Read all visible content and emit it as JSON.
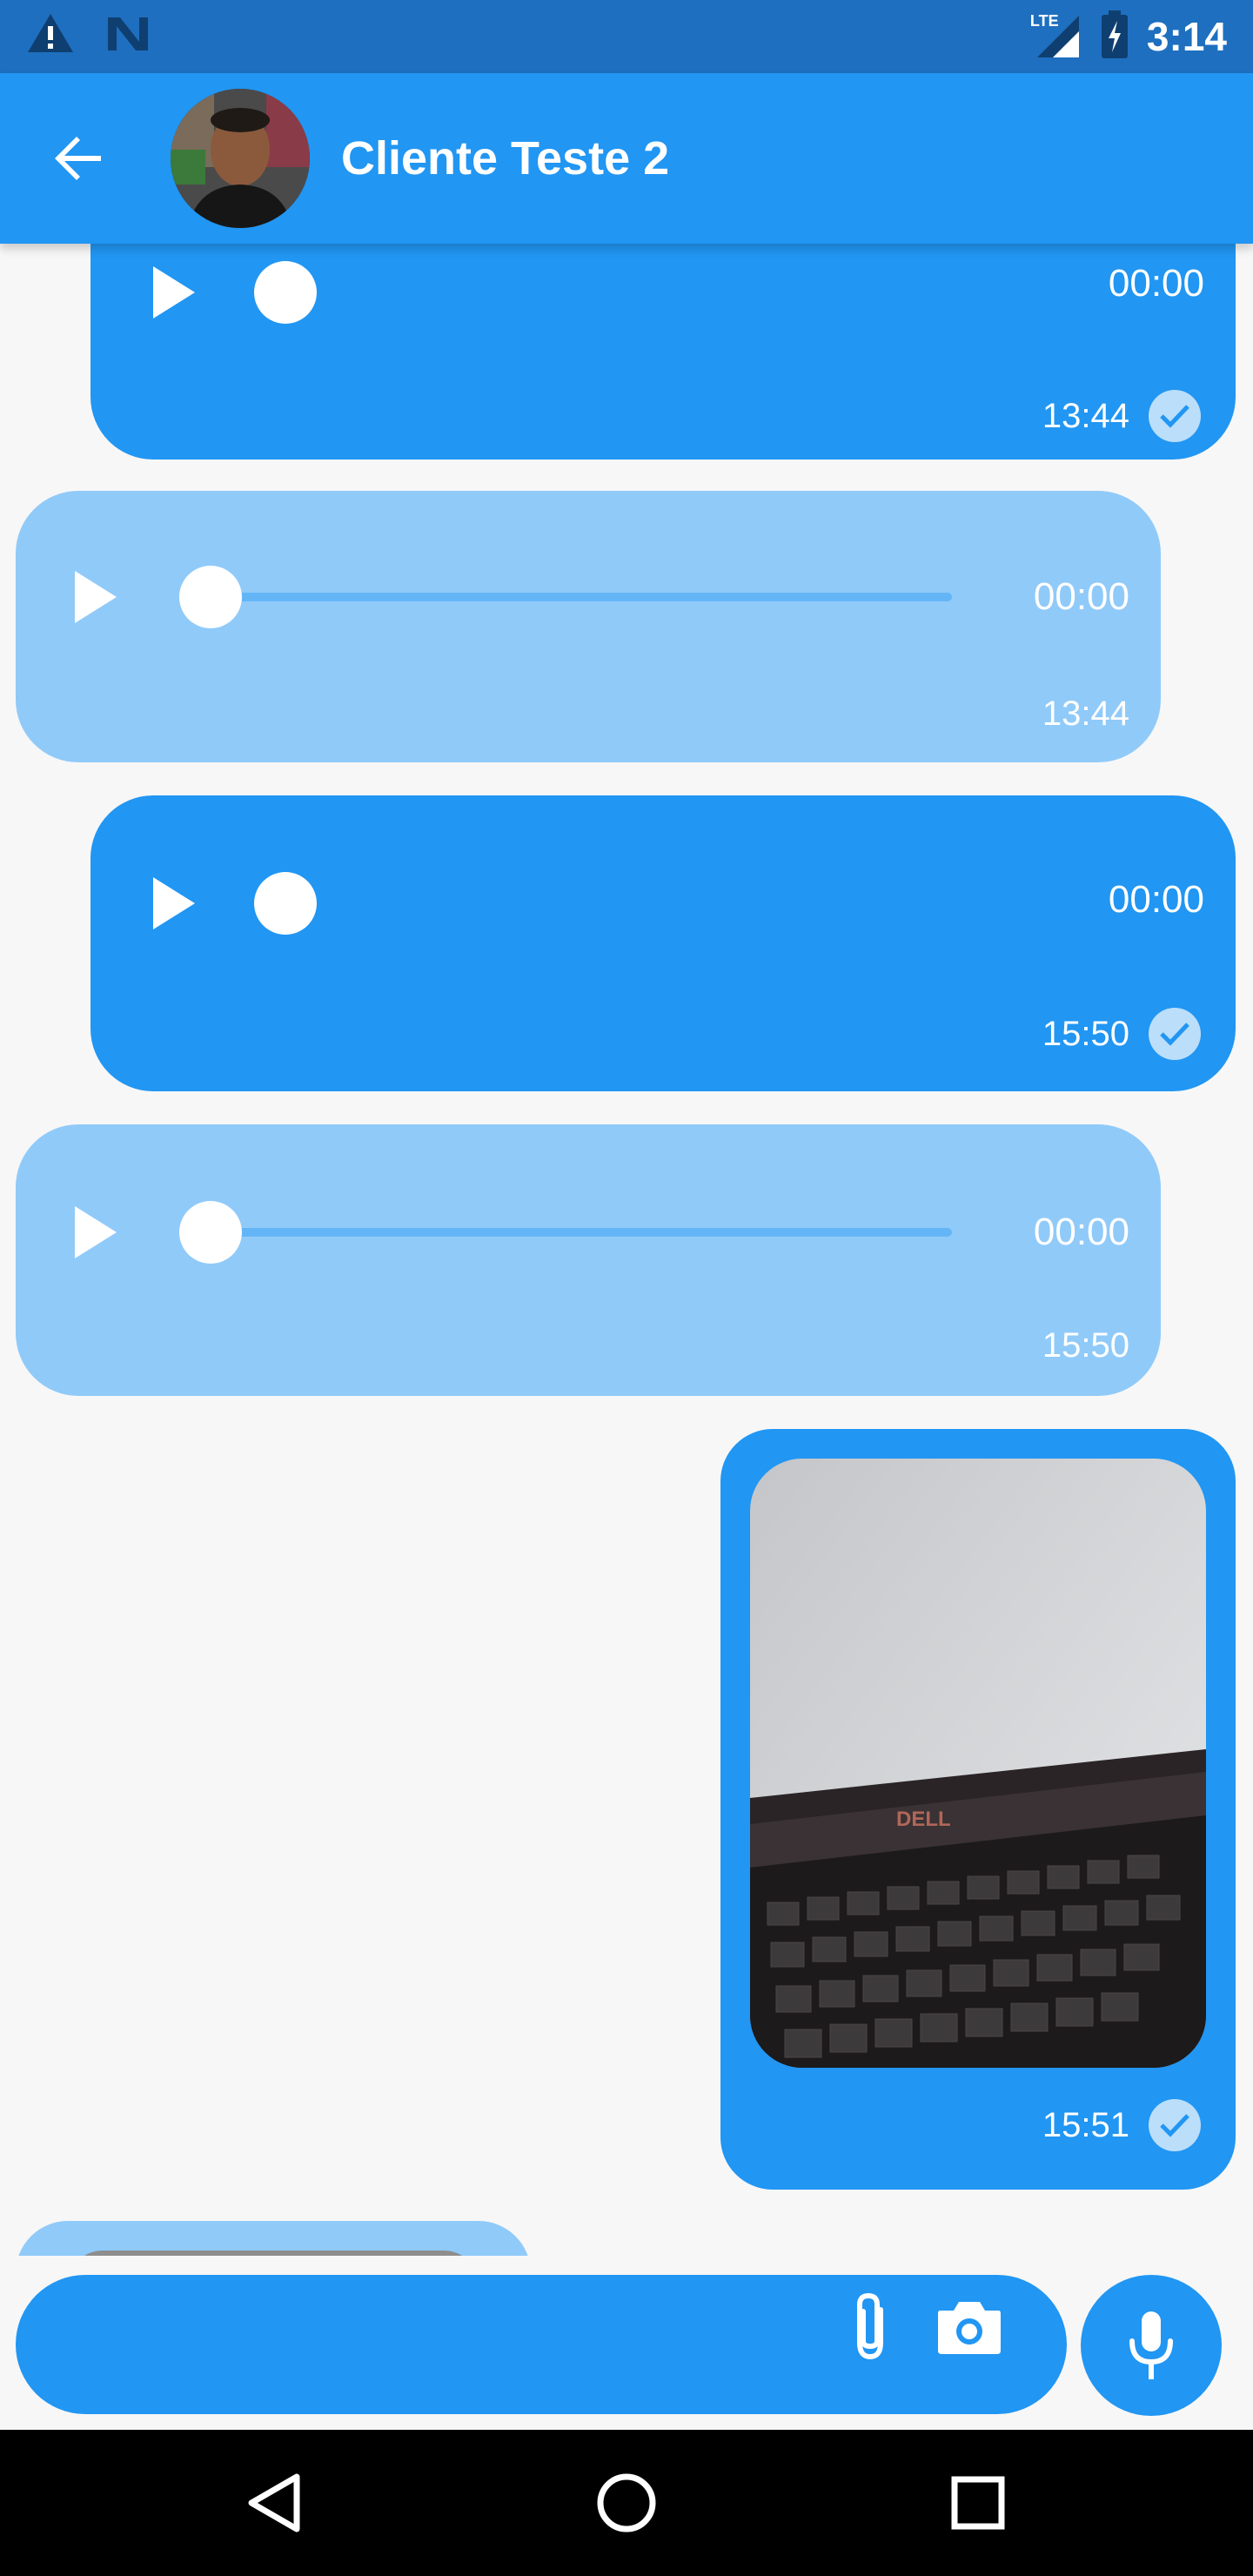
{
  "status_bar": {
    "time": "3:14",
    "network": "LTE",
    "left_icons": [
      "warning-icon",
      "n-notification-icon"
    ],
    "right_icons": [
      "signal-icon",
      "battery-charging-icon"
    ]
  },
  "header": {
    "title": "Cliente Teste 2",
    "back_icon": "arrow-back-icon",
    "avatar": "contact-avatar"
  },
  "messages": [
    {
      "type": "audio",
      "direction": "sent",
      "duration": "00:00",
      "time": "13:44",
      "read": true,
      "cut_off_top": true
    },
    {
      "type": "audio",
      "direction": "received",
      "duration": "00:00",
      "time": "13:44",
      "progress": 0
    },
    {
      "type": "audio",
      "direction": "sent",
      "duration": "00:00",
      "time": "15:50",
      "read": true
    },
    {
      "type": "audio",
      "direction": "received",
      "duration": "00:00",
      "time": "15:50",
      "progress": 0
    },
    {
      "type": "image",
      "direction": "sent",
      "image": "laptop-keyboard-photo",
      "brand_text": "DELL",
      "time": "15:51",
      "read": true
    },
    {
      "type": "image",
      "direction": "received",
      "cut_off_bottom": true
    }
  ],
  "input": {
    "placeholder": "",
    "attach_icon": "paperclip-icon",
    "camera_icon": "camera-icon",
    "mic_icon": "microphone-icon"
  },
  "nav": {
    "back_icon": "nav-back-triangle-icon",
    "home_icon": "nav-home-circle-icon",
    "recents_icon": "nav-recents-square-icon"
  },
  "colors": {
    "primary": "#2196f3",
    "status_bar": "#1e6fbf",
    "received_bubble": "#90caf9",
    "background": "#f7f7f7"
  }
}
